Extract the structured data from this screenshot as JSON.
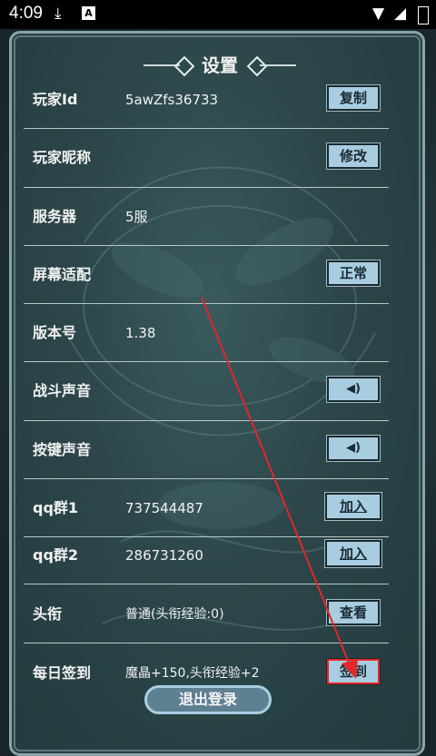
{
  "status_bar": {
    "time": "4:09",
    "icons": [
      "download-icon",
      "a-notification-icon",
      "wifi-icon",
      "signal-icon",
      "battery-icon"
    ]
  },
  "settings": {
    "title": "设置",
    "rows": [
      {
        "label": "玩家Id",
        "value": "5awZfs36733",
        "button": "复制"
      },
      {
        "label": "玩家昵称",
        "value": "",
        "button": "修改"
      },
      {
        "label": "服务器",
        "value": "5服",
        "button": ""
      },
      {
        "label": "屏幕适配",
        "value": "",
        "button": "正常"
      },
      {
        "label": "版本号",
        "value": "1.38",
        "button": ""
      },
      {
        "label": "战斗声音",
        "value": "",
        "button": "speaker-icon"
      },
      {
        "label": "按键声音",
        "value": "",
        "button": "speaker-icon"
      },
      {
        "label": "qq群1",
        "value": "737544487",
        "button": "加入"
      },
      {
        "label": "qq群2",
        "value": "286731260",
        "button": "加入"
      },
      {
        "label": "头衔",
        "value": "普通(头衔经验:0)",
        "button": "查看"
      },
      {
        "label": "每日签到",
        "value": "魔晶+150,头衔经验+2",
        "button": "签到"
      }
    ],
    "logout_label": "退出登录"
  },
  "colors": {
    "panel_bg": "#2c4649",
    "button_bg": "#a9cde0",
    "annotation_red": "#e0272b"
  }
}
